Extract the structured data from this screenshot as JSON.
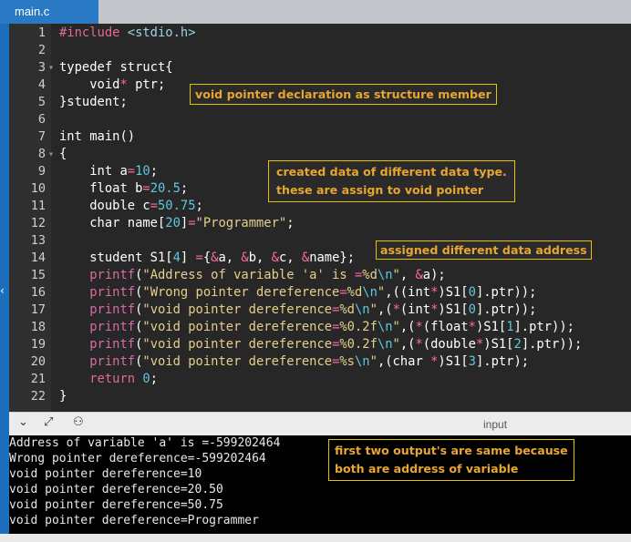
{
  "tab": {
    "filename": "main.c"
  },
  "code": {
    "lines": [
      {
        "n": "1",
        "fold": "",
        "segs": [
          [
            "inc",
            "#include "
          ],
          [
            "hdr",
            "<stdio.h>"
          ]
        ]
      },
      {
        "n": "2",
        "fold": "",
        "segs": []
      },
      {
        "n": "3",
        "fold": "▾",
        "segs": [
          [
            "kw",
            "typedef struct{"
          ]
        ]
      },
      {
        "n": "4",
        "fold": "",
        "segs": [
          [
            "kw",
            "    void"
          ],
          [
            "op",
            "*"
          ],
          [
            "kw",
            " ptr;"
          ]
        ]
      },
      {
        "n": "5",
        "fold": "",
        "segs": [
          [
            "kw",
            "}student;"
          ]
        ]
      },
      {
        "n": "6",
        "fold": "",
        "segs": []
      },
      {
        "n": "7",
        "fold": "",
        "segs": [
          [
            "kw",
            "int main()"
          ]
        ]
      },
      {
        "n": "8",
        "fold": "▾",
        "segs": [
          [
            "kw",
            "{"
          ]
        ]
      },
      {
        "n": "9",
        "fold": "",
        "segs": [
          [
            "kw",
            "    int a"
          ],
          [
            "op",
            "="
          ],
          [
            "num",
            "10"
          ],
          [
            "kw",
            ";"
          ]
        ]
      },
      {
        "n": "10",
        "fold": "",
        "segs": [
          [
            "kw",
            "    float b"
          ],
          [
            "op",
            "="
          ],
          [
            "num",
            "20.5"
          ],
          [
            "kw",
            ";"
          ]
        ]
      },
      {
        "n": "11",
        "fold": "",
        "segs": [
          [
            "kw",
            "    double c"
          ],
          [
            "op",
            "="
          ],
          [
            "num",
            "50.75"
          ],
          [
            "kw",
            ";"
          ]
        ]
      },
      {
        "n": "12",
        "fold": "",
        "segs": [
          [
            "kw",
            "    char name["
          ],
          [
            "num",
            "20"
          ],
          [
            "kw",
            "]"
          ],
          [
            "op",
            "="
          ],
          [
            "str",
            "\"Programmer\""
          ],
          [
            "kw",
            ";"
          ]
        ]
      },
      {
        "n": "13",
        "fold": "",
        "segs": []
      },
      {
        "n": "14",
        "fold": "",
        "segs": [
          [
            "kw",
            "    student S1["
          ],
          [
            "num",
            "4"
          ],
          [
            "kw",
            "] "
          ],
          [
            "op",
            "="
          ],
          [
            "kw",
            "{"
          ],
          [
            "op",
            "&"
          ],
          [
            "kw",
            "a, "
          ],
          [
            "op",
            "&"
          ],
          [
            "kw",
            "b, "
          ],
          [
            "op",
            "&"
          ],
          [
            "kw",
            "c, "
          ],
          [
            "op",
            "&"
          ],
          [
            "kw",
            "name};"
          ]
        ]
      },
      {
        "n": "15",
        "fold": "",
        "segs": [
          [
            "fn",
            "    printf"
          ],
          [
            "kw",
            "("
          ],
          [
            "str",
            "\"Address of variable 'a' is "
          ],
          [
            "op",
            "="
          ],
          [
            "str",
            "%d"
          ],
          [
            "num",
            "\\n"
          ],
          [
            "str",
            "\""
          ],
          [
            "kw",
            ", "
          ],
          [
            "op",
            "&"
          ],
          [
            "kw",
            "a);"
          ]
        ]
      },
      {
        "n": "16",
        "fold": "",
        "segs": [
          [
            "fn",
            "    printf"
          ],
          [
            "kw",
            "("
          ],
          [
            "str",
            "\"Wrong pointer dereference"
          ],
          [
            "op",
            "="
          ],
          [
            "str",
            "%d"
          ],
          [
            "num",
            "\\n"
          ],
          [
            "str",
            "\""
          ],
          [
            "kw",
            ",((int"
          ],
          [
            "op",
            "*"
          ],
          [
            "kw",
            ")S1["
          ],
          [
            "num",
            "0"
          ],
          [
            "kw",
            "].ptr));"
          ]
        ]
      },
      {
        "n": "17",
        "fold": "",
        "segs": [
          [
            "fn",
            "    printf"
          ],
          [
            "kw",
            "("
          ],
          [
            "str",
            "\"void pointer dereference"
          ],
          [
            "op",
            "="
          ],
          [
            "str",
            "%d"
          ],
          [
            "num",
            "\\n"
          ],
          [
            "str",
            "\""
          ],
          [
            "kw",
            ",("
          ],
          [
            "op",
            "*"
          ],
          [
            "kw",
            "(int"
          ],
          [
            "op",
            "*"
          ],
          [
            "kw",
            ")S1["
          ],
          [
            "num",
            "0"
          ],
          [
            "kw",
            "].ptr));"
          ]
        ]
      },
      {
        "n": "18",
        "fold": "",
        "segs": [
          [
            "fn",
            "    printf"
          ],
          [
            "kw",
            "("
          ],
          [
            "str",
            "\"void pointer dereference"
          ],
          [
            "op",
            "="
          ],
          [
            "str",
            "%0.2f"
          ],
          [
            "num",
            "\\n"
          ],
          [
            "str",
            "\""
          ],
          [
            "kw",
            ",("
          ],
          [
            "op",
            "*"
          ],
          [
            "kw",
            "(float"
          ],
          [
            "op",
            "*"
          ],
          [
            "kw",
            ")S1["
          ],
          [
            "num",
            "1"
          ],
          [
            "kw",
            "].ptr));"
          ]
        ]
      },
      {
        "n": "19",
        "fold": "",
        "segs": [
          [
            "fn",
            "    printf"
          ],
          [
            "kw",
            "("
          ],
          [
            "str",
            "\"void pointer dereference"
          ],
          [
            "op",
            "="
          ],
          [
            "str",
            "%0.2f"
          ],
          [
            "num",
            "\\n"
          ],
          [
            "str",
            "\""
          ],
          [
            "kw",
            ",("
          ],
          [
            "op",
            "*"
          ],
          [
            "kw",
            "(double"
          ],
          [
            "op",
            "*"
          ],
          [
            "kw",
            ")S1["
          ],
          [
            "num",
            "2"
          ],
          [
            "kw",
            "].ptr));"
          ]
        ]
      },
      {
        "n": "20",
        "fold": "",
        "segs": [
          [
            "fn",
            "    printf"
          ],
          [
            "kw",
            "("
          ],
          [
            "str",
            "\"void pointer dereference"
          ],
          [
            "op",
            "="
          ],
          [
            "str",
            "%s"
          ],
          [
            "num",
            "\\n"
          ],
          [
            "str",
            "\""
          ],
          [
            "kw",
            ",(char "
          ],
          [
            "op",
            "*"
          ],
          [
            "kw",
            ")S1["
          ],
          [
            "num",
            "3"
          ],
          [
            "kw",
            "].ptr);"
          ]
        ]
      },
      {
        "n": "21",
        "fold": "",
        "segs": [
          [
            "kw2",
            "    return "
          ],
          [
            "num",
            "0"
          ],
          [
            "kw",
            ";"
          ]
        ]
      },
      {
        "n": "22",
        "fold": "",
        "segs": [
          [
            "kw",
            "}"
          ]
        ]
      }
    ]
  },
  "annotations": {
    "struct_note": "void pointer declaration as structure member",
    "data_note_line1": "created data of different data type.",
    "data_note_line2": "these are assign to void pointer",
    "address_note": "assigned different data address",
    "output_note_line1": "first two output's are same because",
    "output_note_line2": "both are address of variable"
  },
  "toolbar": {
    "collapse_glyph": "⌄",
    "expand_glyph": "⤢",
    "user_glyph": "⚇",
    "input_label": "input"
  },
  "output": {
    "lines": [
      "Address of variable 'a' is =-599202464",
      "Wrong pointer dereference=-599202464",
      "void pointer dereference=10",
      "void pointer dereference=20.50",
      "void pointer dereference=50.75",
      "void pointer dereference=Programmer"
    ]
  },
  "colors": {
    "tab_accent": "#2a79c4",
    "note_border": "#e6c200",
    "note_text": "#e8a531"
  }
}
